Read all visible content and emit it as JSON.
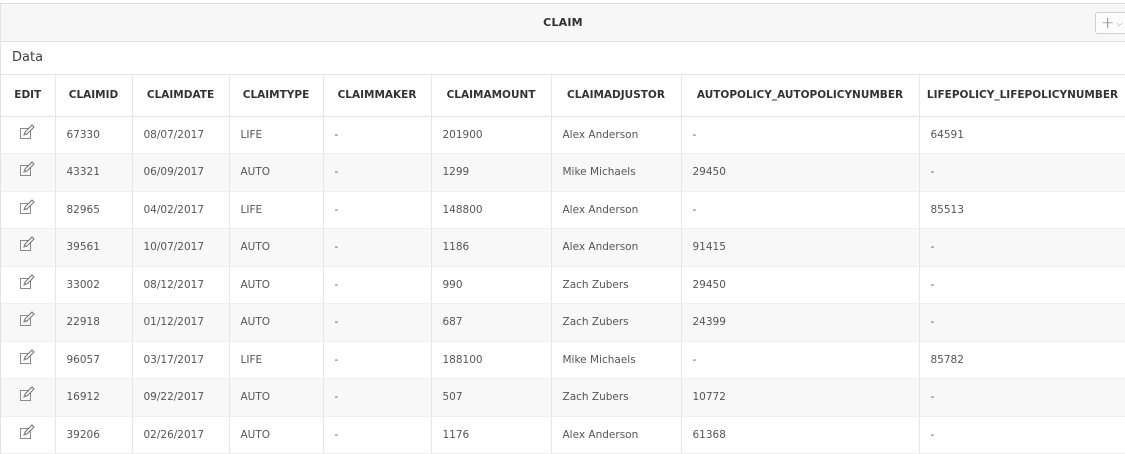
{
  "region": {
    "title": "CLAIM",
    "menu_icon": "plus-icon",
    "menu_chevron": "chevron-down-icon",
    "subbar_label": "Data"
  },
  "table": {
    "columns": [
      "EDIT",
      "CLAIMID",
      "CLAIMDATE",
      "CLAIMTYPE",
      "CLAIMMAKER",
      "CLAIMAMOUNT",
      "CLAIMADJUSTOR",
      "AUTOPOLICY_AUTOPOLICYNUMBER",
      "LIFEPOLICY_LIFEPOLICYNUMBER"
    ],
    "edit_icon": "edit-pencil-icon",
    "rows": [
      {
        "claimid": "67330",
        "claimdate": "08/07/2017",
        "claimtype": "LIFE",
        "claimmaker": "-",
        "claimamount": "201900",
        "claimadjustor": "Alex Anderson",
        "autopolicy": "-",
        "lifepolicy": "64591"
      },
      {
        "claimid": "43321",
        "claimdate": "06/09/2017",
        "claimtype": "AUTO",
        "claimmaker": "-",
        "claimamount": "1299",
        "claimadjustor": "Mike Michaels",
        "autopolicy": "29450",
        "lifepolicy": "-"
      },
      {
        "claimid": "82965",
        "claimdate": "04/02/2017",
        "claimtype": "LIFE",
        "claimmaker": "-",
        "claimamount": "148800",
        "claimadjustor": "Alex Anderson",
        "autopolicy": "-",
        "lifepolicy": "85513"
      },
      {
        "claimid": "39561",
        "claimdate": "10/07/2017",
        "claimtype": "AUTO",
        "claimmaker": "-",
        "claimamount": "1186",
        "claimadjustor": "Alex Anderson",
        "autopolicy": "91415",
        "lifepolicy": "-"
      },
      {
        "claimid": "33002",
        "claimdate": "08/12/2017",
        "claimtype": "AUTO",
        "claimmaker": "-",
        "claimamount": "990",
        "claimadjustor": "Zach Zubers",
        "autopolicy": "29450",
        "lifepolicy": "-"
      },
      {
        "claimid": "22918",
        "claimdate": "01/12/2017",
        "claimtype": "AUTO",
        "claimmaker": "-",
        "claimamount": "687",
        "claimadjustor": "Zach Zubers",
        "autopolicy": "24399",
        "lifepolicy": "-"
      },
      {
        "claimid": "96057",
        "claimdate": "03/17/2017",
        "claimtype": "LIFE",
        "claimmaker": "-",
        "claimamount": "188100",
        "claimadjustor": "Mike Michaels",
        "autopolicy": "-",
        "lifepolicy": "85782"
      },
      {
        "claimid": "16912",
        "claimdate": "09/22/2017",
        "claimtype": "AUTO",
        "claimmaker": "-",
        "claimamount": "507",
        "claimadjustor": "Zach Zubers",
        "autopolicy": "10772",
        "lifepolicy": "-"
      },
      {
        "claimid": "39206",
        "claimdate": "02/26/2017",
        "claimtype": "AUTO",
        "claimmaker": "-",
        "claimamount": "1176",
        "claimadjustor": "Alex Anderson",
        "autopolicy": "61368",
        "lifepolicy": "-"
      }
    ]
  }
}
